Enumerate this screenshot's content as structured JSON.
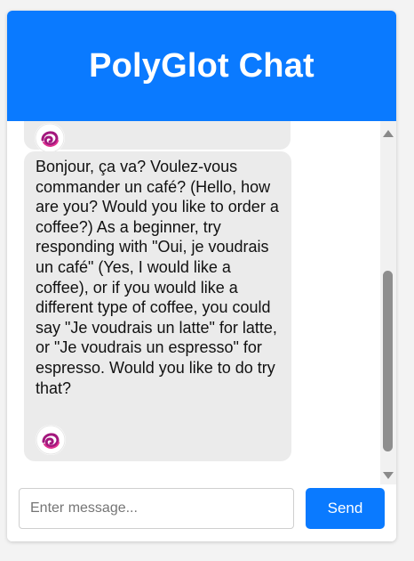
{
  "header": {
    "title": "PolyGlot Chat"
  },
  "messages": [
    {
      "role": "bot",
      "text": "",
      "avatar_icon": "polyglot-swirl-icon"
    },
    {
      "role": "bot",
      "text": "Bonjour, ça va? Voulez-vous commander un café? (Hello, how are you? Would you like to order a coffee?) As a beginner, try responding with \"Oui, je voudrais un café\" (Yes, I would like a coffee), or if you would like a different type of coffee, you could say \"Je voudrais un latte\" for latte, or \"Je voudrais un espresso\" for espresso. Would you like to do try that?",
      "avatar_icon": "polyglot-swirl-icon"
    }
  ],
  "composer": {
    "placeholder": "Enter message...",
    "value": "",
    "send_label": "Send"
  },
  "colors": {
    "accent": "#0a7aff",
    "bubble": "#ebebeb"
  }
}
